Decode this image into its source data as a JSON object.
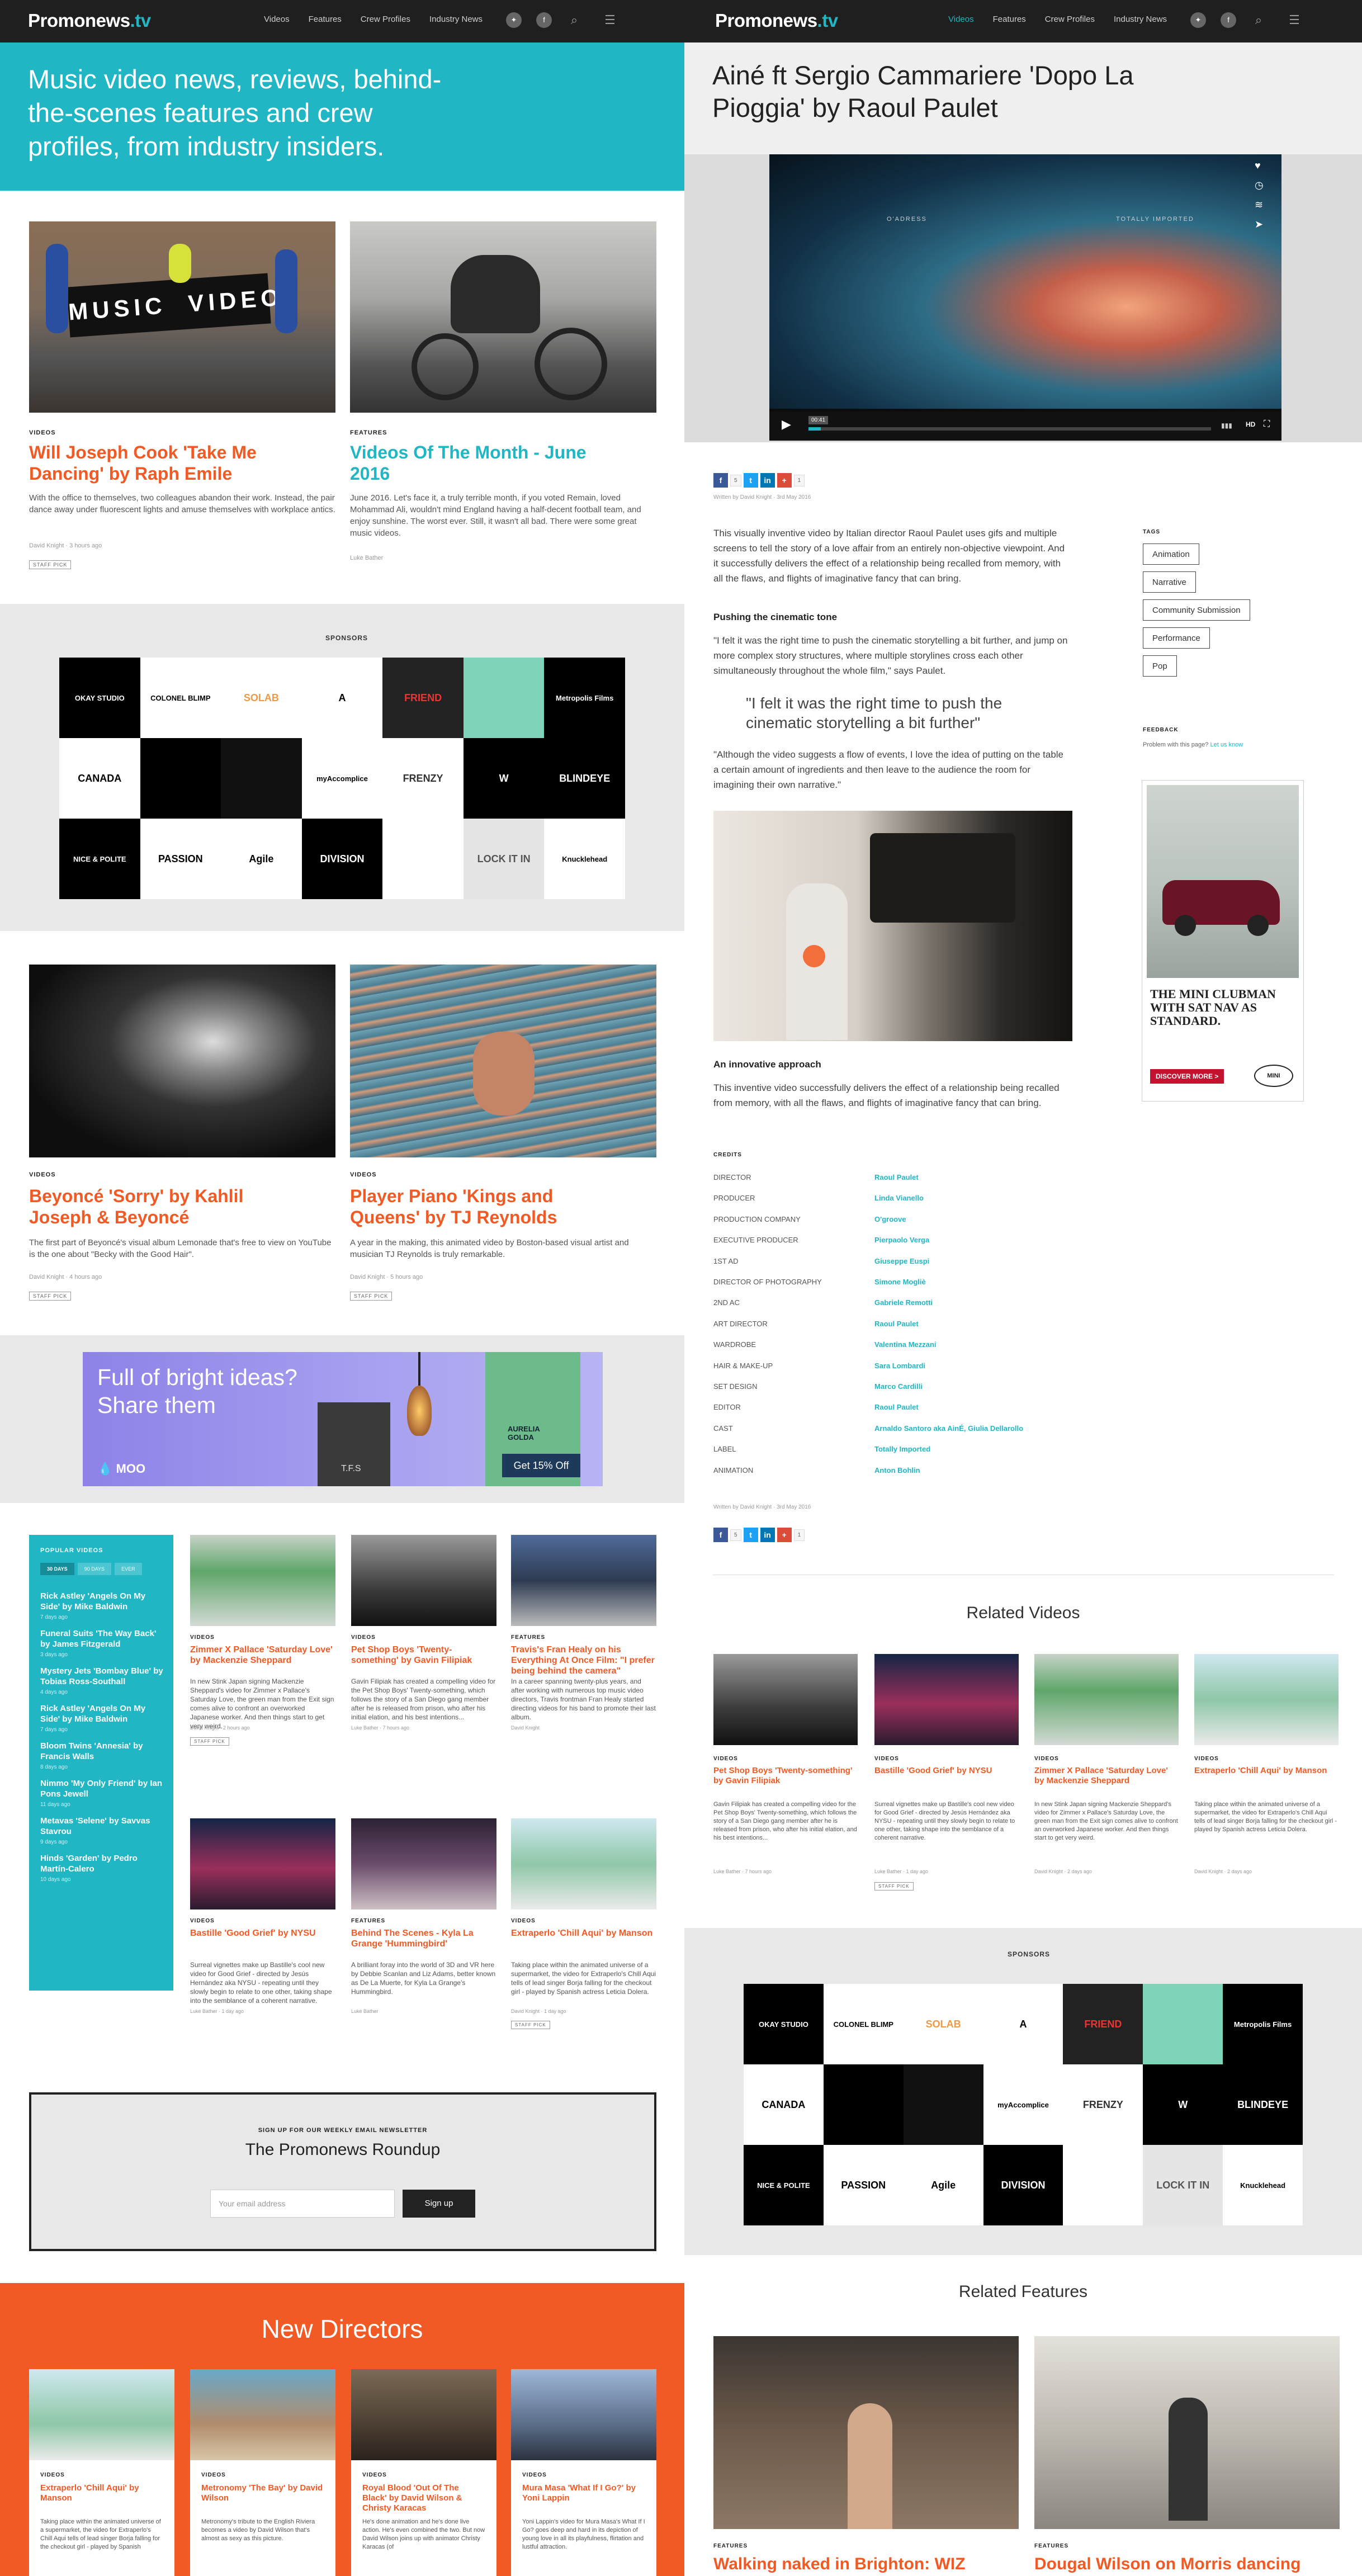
{
  "site": {
    "logo_main": "Promonews",
    "logo_tv": ".tv"
  },
  "nav": [
    "Videos",
    "Features",
    "Crew Profiles",
    "Industry News"
  ],
  "colors": {
    "teal": "#20b6c4",
    "orange": "#f15a24",
    "dark": "#1f1f1f"
  },
  "left": {
    "hero_text": "Music video news, reviews, behind-the-scenes features and crew profiles, from industry insiders.",
    "top_cards": [
      {
        "tag": "VIDEOS",
        "title": "Will Joseph Cook 'Take Me Dancing' by Raph Emile",
        "desc": "With the office to themselves, two colleagues abandon their work. Instead, the pair dance away under fluorescent lights and amuse themselves with workplace antics.",
        "meta": "David Knight · 3 hours ago",
        "pill": "STAFF PICK"
      },
      {
        "tag": "FEATURES",
        "title": "Videos Of The Month - June 2016",
        "desc": "June 2016. Let's face it, a truly terrible month, if you voted Remain, loved Mohammad Ali, wouldn't mind England having a half-decent football team, and enjoy sunshine. The worst ever. Still, it wasn't all bad. There were some great music videos.",
        "meta": "Luke Bather"
      }
    ],
    "sponsors_title": "SPONSORS",
    "mid_cards": [
      {
        "tag": "VIDEOS",
        "title": "Beyoncé 'Sorry' by Kahlil Joseph & Beyoncé",
        "desc": "The first part of Beyoncé's visual album Lemonade that's free to view on YouTube is the one about \"Becky with the Good Hair\".",
        "meta": "David Knight · 4 hours ago",
        "pill": "STAFF PICK"
      },
      {
        "tag": "VIDEOS",
        "title": "Player Piano 'Kings and Queens' by TJ Reynolds",
        "desc": "A year in the making, this animated video by Boston-based visual artist and musician TJ Reynolds is truly remarkable.",
        "meta": "David Knight · 5 hours ago",
        "pill": "STAFF PICK"
      }
    ],
    "moo_ad": {
      "headline": "Full of bright ideas? Share them",
      "brand": "MOO",
      "cta": "Get 15% Off",
      "card_text": "AURELIA GOLDA",
      "badge": "T.F.S"
    },
    "popular": {
      "title": "POPULAR VIDEOS",
      "tabs": [
        "30 DAYS",
        "90 DAYS",
        "EVER"
      ],
      "items": [
        {
          "title": "Rick Astley 'Angels On My Side' by Mike Baldwin",
          "date": "7 days ago"
        },
        {
          "title": "Funeral Suits 'The Way Back' by James Fitzgerald",
          "date": "3 days ago"
        },
        {
          "title": "Mystery Jets 'Bombay Blue' by Tobias Ross-Southall",
          "date": "4 days ago"
        },
        {
          "title": "Rick Astley 'Angels On My Side' by Mike Baldwin",
          "date": "7 days ago"
        },
        {
          "title": "Bloom Twins 'Annesia' by Francis Walls",
          "date": "8 days ago"
        },
        {
          "title": "Nimmo 'My Only Friend' by Ian Pons Jewell",
          "date": "11 days ago"
        },
        {
          "title": "Metavas 'Selene' by Savvas Stavrou",
          "date": "9 days ago"
        },
        {
          "title": "Hinds 'Garden' by Pedro Martín-Calero",
          "date": "10 days ago"
        }
      ]
    },
    "grid_cards": [
      {
        "tag": "VIDEOS",
        "title": "Zimmer X Pallace 'Saturday Love' by Mackenzie Sheppard",
        "desc": "In new Stink Japan signing Mackenzie Sheppard's video for Zimmer x Pallace's Saturday Love, the green man from the Exit sign comes alive to confront an overworked Japanese worker. And then things start to get very weird.",
        "meta": "David Knight · 2 hours ago",
        "pill": "STAFF PICK"
      },
      {
        "tag": "VIDEOS",
        "title": "Pet Shop Boys 'Twenty-something' by Gavin Filipiak",
        "desc": "Gavin Filipiak has created a compelling video for the Pet Shop Boys' Twenty-something, which follows the story of a San Diego gang member after he is released from prison, who after his initial elation, and his best intentions...",
        "meta": "Luke Bather · 7 hours ago"
      },
      {
        "tag": "FEATURES",
        "title": "Travis's Fran Healy on his Everything At Once Film: \"I prefer being behind the camera\"",
        "desc": "In a career spanning twenty-plus years, and after working with numerous top music video directors, Travis frontman Fran Healy started directing videos for his band to promote their last album.",
        "meta": "David Knight"
      },
      {
        "tag": "VIDEOS",
        "title": "Bastille 'Good Grief' by NYSU",
        "desc": "Surreal vignettes make up Bastille's cool new video for Good Grief - directed by Jesús Hernández aka NYSU - repeating until they slowly begin to relate to one other, taking shape into the semblance of a coherent narrative.",
        "meta": "Luke Bather · 1 day ago"
      },
      {
        "tag": "FEATURES",
        "title": "Behind The Scenes - Kyla La Grange 'Hummingbird'",
        "desc": "A brilliant foray into the world of 3D and VR here by Debbie Scanlan and Liz Adams, better known as De La Muerte, for Kyla La Grange's Hummingbird.",
        "meta": "Luke Bather"
      },
      {
        "tag": "VIDEOS",
        "title": "Extraperlo 'Chill Aqui' by Manson",
        "desc": "Taking place within the animated universe of a supermarket, the video for Extraperlo's Chill Aqui tells of lead singer Borja falling for the checkout girl - played by Spanish actress Leticia Dolera.",
        "meta": "David Knight · 1 day ago",
        "pill": "STAFF PICK"
      }
    ],
    "newsletter": {
      "kicker": "SIGN UP FOR OUR WEEKLY EMAIL NEWSLETTER",
      "title": "The Promonews Roundup",
      "placeholder": "Your email address",
      "button": "Sign up"
    },
    "new_directors": {
      "title": "New Directors",
      "cards": [
        {
          "tag": "VIDEOS",
          "title": "Extraperlo 'Chill Aqui' by Manson",
          "desc": "Taking place within the animated universe of a supermarket, the video for Extraperlo's Chill Aqui tells of lead singer Borja falling for the checkout girl - played by Spanish"
        },
        {
          "tag": "VIDEOS",
          "title": "Metronomy 'The Bay' by David Wilson",
          "desc": "Metronomy's tribute to the English Riviera becomes a video by David Wilson that's almost as sexy as this picture."
        },
        {
          "tag": "VIDEOS",
          "title": "Royal Blood 'Out Of The Black' by David Wilson & Christy Karacas",
          "desc": "He's done animation and he's done live action. He's even combined the two. But now David Wilson joins up with animator Christy Karacas (of"
        },
        {
          "tag": "VIDEOS",
          "title": "Mura Masa 'What If I Go?' by Yoni Lappin",
          "desc": "Yoni Lappin's video for Mura Masa's What If I Go? goes deep and hard in its depiction of young love in all its playfulness, flirtation and lustful attraction."
        }
      ]
    }
  },
  "right": {
    "article_title": "Ainé ft Sergio Cammariere 'Dopo La Pioggia' by Raoul Paulet",
    "video": {
      "time": "00:41",
      "hd": "HD",
      "overlay_left": "O'ADRESS",
      "overlay_right": "TOTALLY IMPORTED"
    },
    "share_counts": [
      "5",
      "1"
    ],
    "intro": "This visually inventive video by Italian director Raoul Paulet uses gifs and multiple screens to tell the story of a love affair from an entirely non-objective viewpoint. And it successfully delivers the effect of a relationship being recalled from memory, with all the flaws, and flights of imaginative fancy that can bring.",
    "subhead1": "Pushing the cinematic tone",
    "para2": "\"I felt it was the right time to push the cinematic storytelling a bit further, and jump on more complex story structures, where multiple storylines cross each other simultaneously throughout the whole film,\" says Paulet.",
    "quote": "\"I felt it was the right time to push the cinematic storytelling a bit further\"",
    "para3": "\"Although the video suggests a flow of events, I love the idea of putting on the table a certain amount of ingredients and then leave to the audience the room for imagining their own narrative.\"",
    "subhead2": "An innovative approach",
    "para4": "This inventive video successfully delivers the effect of a relationship being recalled from memory, with all the flaws, and flights of imaginative fancy that can bring.",
    "credits_title": "CREDITS",
    "credits": [
      {
        "k": "DIRECTOR",
        "v": "Raoul Paulet"
      },
      {
        "k": "PRODUCER",
        "v": "Linda Vianello"
      },
      {
        "k": "PRODUCTION COMPANY",
        "v": "O'groove"
      },
      {
        "k": "EXECUTIVE PRODUCER",
        "v": "Pierpaolo Verga"
      },
      {
        "k": "1ST AD",
        "v": "Giuseppe Euspi"
      },
      {
        "k": "DIRECTOR OF PHOTOGRAPHY",
        "v": "Simone Mogliè"
      },
      {
        "k": "2ND AC",
        "v": "Gabriele Remotti"
      },
      {
        "k": "ART DIRECTOR",
        "v": "Raoul Paulet"
      },
      {
        "k": "WARDROBE",
        "v": "Valentina Mezzani"
      },
      {
        "k": "HAIR & MAKE-UP",
        "v": "Sara Lombardi"
      },
      {
        "k": "SET DESIGN",
        "v": "Marco Cardilli"
      },
      {
        "k": "EDITOR",
        "v": "Raoul Paulet"
      },
      {
        "k": "CAST",
        "v": "Arnaldo Santoro aka AinÉ, Giulia Dellarollo"
      },
      {
        "k": "LABEL",
        "v": "Totally Imported"
      },
      {
        "k": "ANIMATION",
        "v": "Anton Bohlin"
      }
    ],
    "written_by": "Written by David Knight · 3rd May 2016",
    "tags_title": "TAGS",
    "tags": [
      "Animation",
      "Narrative",
      "Community Submission",
      "Performance",
      "Pop"
    ],
    "feedback_title": "FEEDBACK",
    "feedback_text": "Problem with this page?",
    "feedback_link": "Let us know",
    "mini_ad": {
      "headline": "THE MINI CLUBMAN WITH SAT NAV AS STANDARD.",
      "cta": "DISCOVER MORE >",
      "brand": "MINI"
    },
    "related_videos_title": "Related Videos",
    "related_videos": [
      {
        "tag": "VIDEOS",
        "title": "Pet Shop Boys 'Twenty-something' by Gavin Filipiak",
        "desc": "Gavin Filipiak has created a compelling video for the Pet Shop Boys' Twenty-something, which follows the story of a San Diego gang member after he is released from prison, who after his initial elation, and his best intentions...",
        "meta": "Luke Bather · 7 hours ago"
      },
      {
        "tag": "VIDEOS",
        "title": "Bastille 'Good Grief' by NYSU",
        "desc": "Surreal vignettes make up Bastille's cool new video for Good Grief - directed by Jesús Hernández aka NYSU - repeating until they slowly begin to relate to one other, taking shape into the semblance of a coherent narrative.",
        "meta": "Luke Bather · 1 day ago",
        "pill": "STAFF PICK"
      },
      {
        "tag": "VIDEOS",
        "title": "Zimmer X Pallace 'Saturday Love' by Mackenzie Sheppard",
        "desc": "In new Stink Japan signing Mackenzie Sheppard's video for Zimmer x Pallace's Saturday Love, the green man from the Exit sign comes alive to confront an overworked Japanese worker. And then things start to get very weird.",
        "meta": "David Knight · 2 days ago"
      },
      {
        "tag": "VIDEOS",
        "title": "Extraperlo 'Chill Aqui' by Manson",
        "desc": "Taking place within the animated universe of a supermarket, the video for Extraperlo's Chill Aqui tells of lead singer Borja falling for the checkout girl - played by Spanish actress Leticia Dolera.",
        "meta": "David Knight · 2 days ago"
      }
    ],
    "sponsors_title": "SPONSORS",
    "related_features_title": "Related Features",
    "related_features": [
      {
        "tag": "FEATURES",
        "title": "Walking naked in Brighton: WIZ"
      },
      {
        "tag": "FEATURES",
        "title": "Dougal Wilson on Morris dancing"
      }
    ]
  },
  "sponsors": [
    {
      "name": "OKAY STUDIO",
      "bg": "#000",
      "fg": "#fff"
    },
    {
      "name": "COLONEL BLIMP",
      "bg": "#fff",
      "fg": "#000"
    },
    {
      "name": "SOLAB",
      "bg": "#fff",
      "fg": "#e94"
    },
    {
      "name": "A",
      "bg": "#fff",
      "fg": "#000"
    },
    {
      "name": "FRIEND",
      "bg": "#222",
      "fg": "#e33"
    },
    {
      "name": "",
      "bg": "#7fd3b8",
      "fg": "#333"
    },
    {
      "name": "Metropolis Films",
      "bg": "#000",
      "fg": "#fff"
    },
    {
      "name": "CANADA",
      "bg": "#fff",
      "fg": "#000"
    },
    {
      "name": "",
      "bg": "#000",
      "fg": "#fff"
    },
    {
      "name": "",
      "bg": "#111",
      "fg": "#c9a84a"
    },
    {
      "name": "myAccomplice",
      "bg": "#fff",
      "fg": "#000"
    },
    {
      "name": "FRENZY",
      "bg": "#fff",
      "fg": "#333"
    },
    {
      "name": "W",
      "bg": "#000",
      "fg": "#fff"
    },
    {
      "name": "BLINDEYE",
      "bg": "#000",
      "fg": "#fff"
    },
    {
      "name": "NICE & POLITE",
      "bg": "#000",
      "fg": "#fff"
    },
    {
      "name": "PASSION",
      "bg": "#fff",
      "fg": "#000"
    },
    {
      "name": "Agile",
      "bg": "#fff",
      "fg": "#000"
    },
    {
      "name": "DIVISION",
      "bg": "#000",
      "fg": "#fff"
    },
    {
      "name": "",
      "bg": "#fff",
      "fg": "#000"
    },
    {
      "name": "LOCK IT IN",
      "bg": "#e5e5e5",
      "fg": "#555"
    },
    {
      "name": "Knucklehead",
      "bg": "#fff",
      "fg": "#000"
    }
  ]
}
